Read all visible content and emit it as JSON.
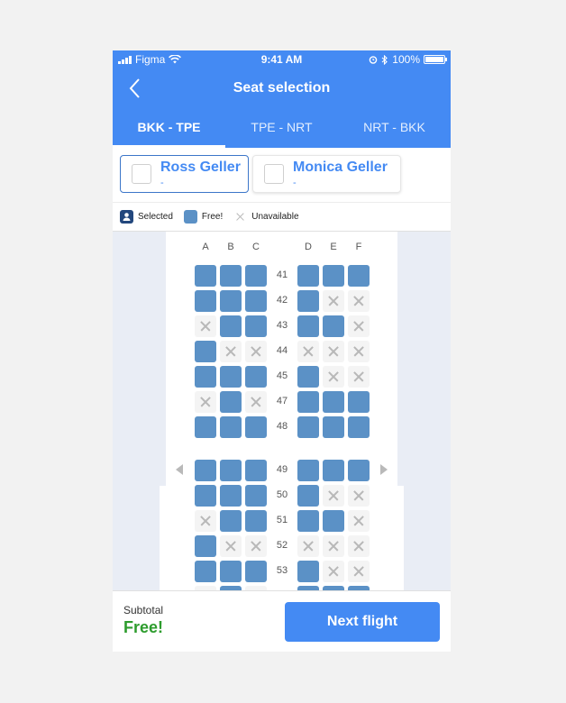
{
  "status_bar": {
    "carrier": "Figma",
    "time": "9:41 AM",
    "battery": "100%"
  },
  "header": {
    "title": "Seat selection",
    "back_icon": "chevron-left-icon"
  },
  "tabs": [
    {
      "label": "BKK - TPE",
      "active": true
    },
    {
      "label": "TPE - NRT",
      "active": false
    },
    {
      "label": "NRT - BKK",
      "active": false
    }
  ],
  "passengers": [
    {
      "name": "Ross Geller",
      "seat": "-",
      "selected": true
    },
    {
      "name": "Monica Geller",
      "seat": "-",
      "selected": false
    }
  ],
  "legend": {
    "selected": "Selected",
    "free": "Free!",
    "unavailable": "Unavailable"
  },
  "columns": [
    "A",
    "B",
    "C",
    "D",
    "E",
    "F"
  ],
  "rows": [
    {
      "number": "41",
      "seats": [
        "free",
        "free",
        "free",
        "free",
        "free",
        "free"
      ]
    },
    {
      "number": "42",
      "seats": [
        "free",
        "free",
        "free",
        "free",
        "unavailable",
        "unavailable"
      ]
    },
    {
      "number": "43",
      "seats": [
        "unavailable",
        "free",
        "free",
        "free",
        "free",
        "unavailable"
      ]
    },
    {
      "number": "44",
      "seats": [
        "free",
        "unavailable",
        "unavailable",
        "unavailable",
        "unavailable",
        "unavailable"
      ]
    },
    {
      "number": "45",
      "seats": [
        "free",
        "free",
        "free",
        "free",
        "unavailable",
        "unavailable"
      ]
    },
    {
      "number": "47",
      "seats": [
        "unavailable",
        "free",
        "unavailable",
        "free",
        "free",
        "free"
      ]
    },
    {
      "number": "48",
      "seats": [
        "free",
        "free",
        "free",
        "free",
        "free",
        "free"
      ]
    },
    {
      "number": "49",
      "seats": [
        "free",
        "free",
        "free",
        "free",
        "free",
        "free"
      ]
    },
    {
      "number": "50",
      "seats": [
        "free",
        "free",
        "free",
        "free",
        "unavailable",
        "unavailable"
      ]
    },
    {
      "number": "51",
      "seats": [
        "unavailable",
        "free",
        "free",
        "free",
        "free",
        "unavailable"
      ]
    },
    {
      "number": "52",
      "seats": [
        "free",
        "unavailable",
        "unavailable",
        "unavailable",
        "unavailable",
        "unavailable"
      ]
    },
    {
      "number": "53",
      "seats": [
        "free",
        "free",
        "free",
        "free",
        "unavailable",
        "unavailable"
      ]
    },
    {
      "number": "",
      "seats": [
        "unavailable",
        "free",
        "unavailable",
        "free",
        "free",
        "free"
      ]
    }
  ],
  "footer": {
    "subtotal_label": "Subtotal",
    "subtotal_value": "Free!",
    "next_button": "Next flight"
  },
  "colors": {
    "primary": "#448af3",
    "seat_free": "#5b91c6",
    "seat_selected": "#22477d",
    "subtotal_green": "#2d9c2d"
  }
}
